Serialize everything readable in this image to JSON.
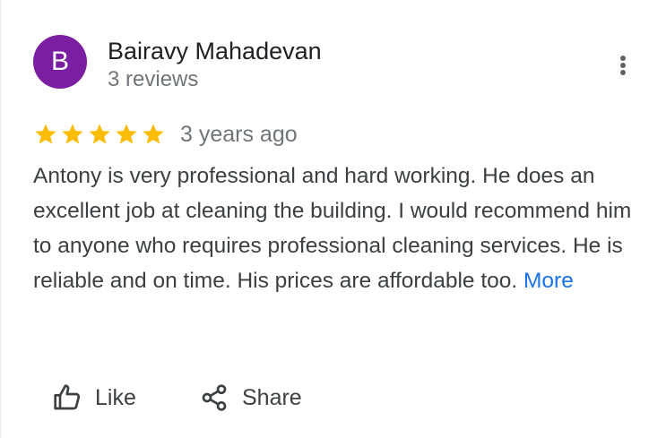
{
  "reviewer": {
    "initial": "B",
    "name": "Bairavy Mahadevan",
    "review_count": "3 reviews",
    "avatar_color": "#7b1fa2"
  },
  "rating": {
    "stars": 5,
    "max_stars": 5,
    "star_color": "#fbbc04",
    "date": "3 years ago"
  },
  "review": {
    "text": "Antony is very professional and hard working. He does an excellent job at cleaning the building. I would recommend him to anyone who requires professional cleaning services. He is reliable and on time. His prices are affordable too. ",
    "more_label": "More"
  },
  "actions": {
    "like_label": "Like",
    "share_label": "Share",
    "more_menu_icon": "more-vert-icon"
  },
  "colors": {
    "link": "#1a73e8",
    "secondary_text": "#70757a"
  }
}
